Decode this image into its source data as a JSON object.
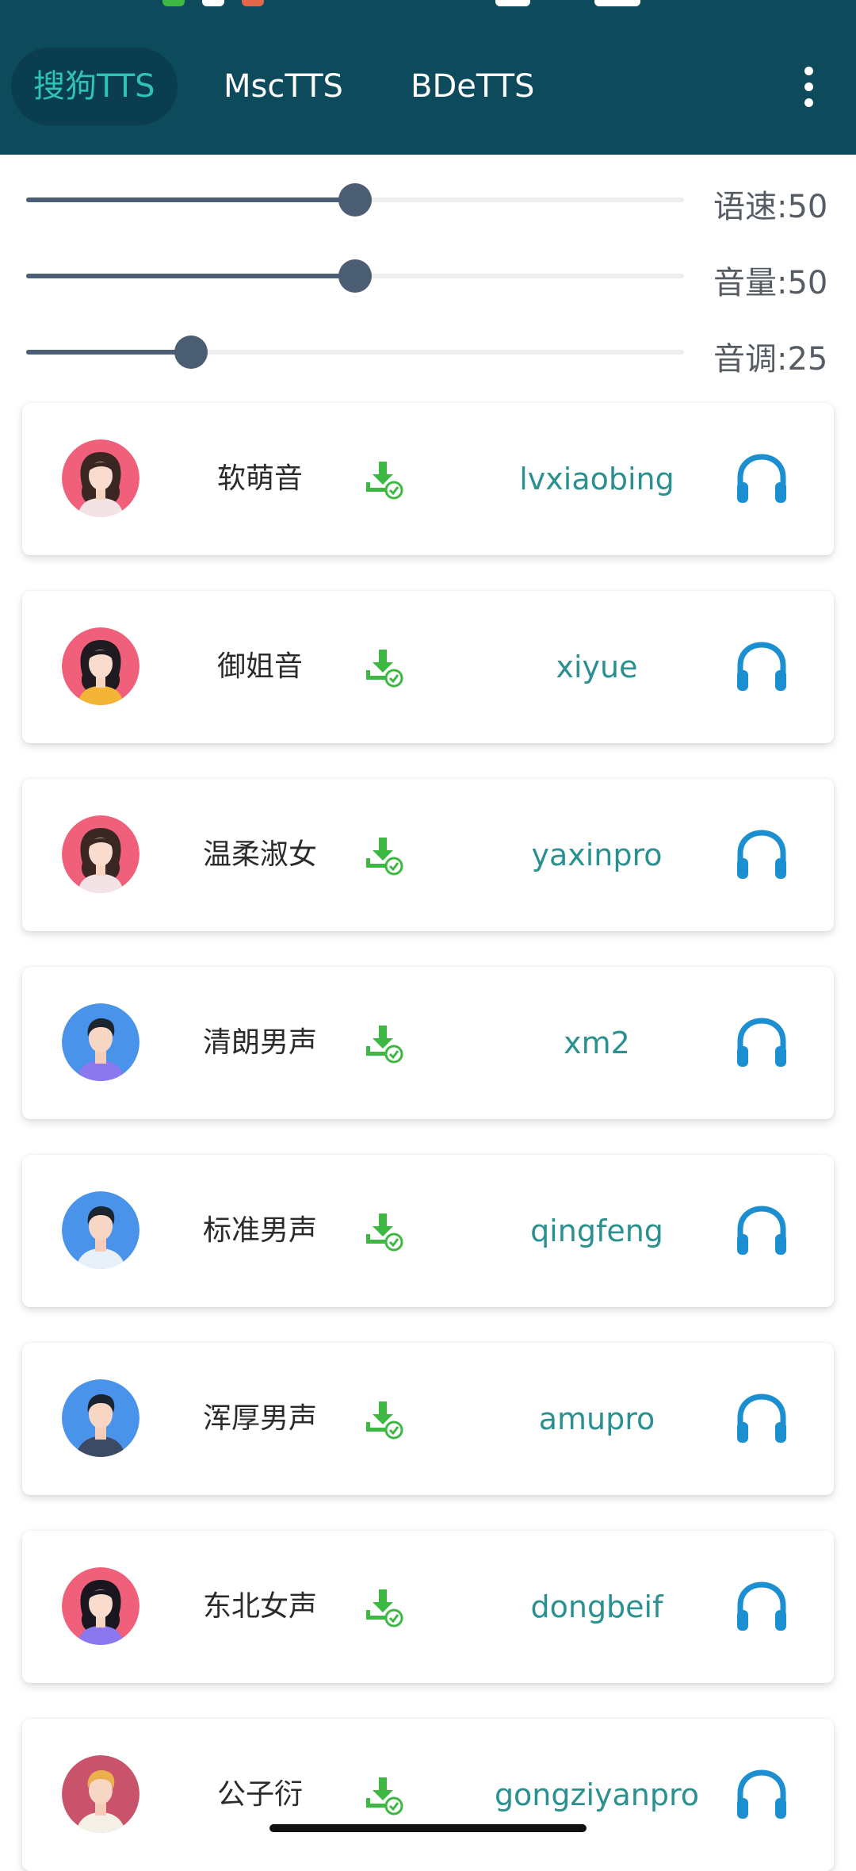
{
  "tabs": [
    {
      "label": "搜狗TTS",
      "active": true
    },
    {
      "label": "MscTTS",
      "active": false
    },
    {
      "label": "BDeTTS",
      "active": false
    }
  ],
  "menu_icon": "more-vertical-icon",
  "sliders": [
    {
      "name": "speed",
      "label": "语速:50",
      "value": 50
    },
    {
      "name": "volume",
      "label": "音量:50",
      "value": 50
    },
    {
      "name": "pitch",
      "label": "音调:25",
      "value": 25
    }
  ],
  "voices": [
    {
      "name": "软萌音",
      "id": "lvxiaobing",
      "gender": "female"
    },
    {
      "name": "御姐音",
      "id": "xiyue",
      "gender": "female"
    },
    {
      "name": "温柔淑女",
      "id": "yaxinpro",
      "gender": "female"
    },
    {
      "name": "清朗男声",
      "id": "xm2",
      "gender": "male"
    },
    {
      "name": "标准男声",
      "id": "qingfeng",
      "gender": "male"
    },
    {
      "name": "浑厚男声",
      "id": "amupro",
      "gender": "male"
    },
    {
      "name": "东北女声",
      "id": "dongbeif",
      "gender": "female"
    },
    {
      "name": "公子衍",
      "id": "gongziyanpro",
      "gender": "male"
    }
  ],
  "icons": {
    "download": "download-check-icon",
    "play": "headphones-icon"
  },
  "colors": {
    "header": "#0d4a5c",
    "active_tab_text": "#2fc2b6",
    "voice_id": "#2a9090",
    "download": "#3cb843",
    "headphones": "#1b8fd0",
    "slider": "#4b5d73"
  }
}
